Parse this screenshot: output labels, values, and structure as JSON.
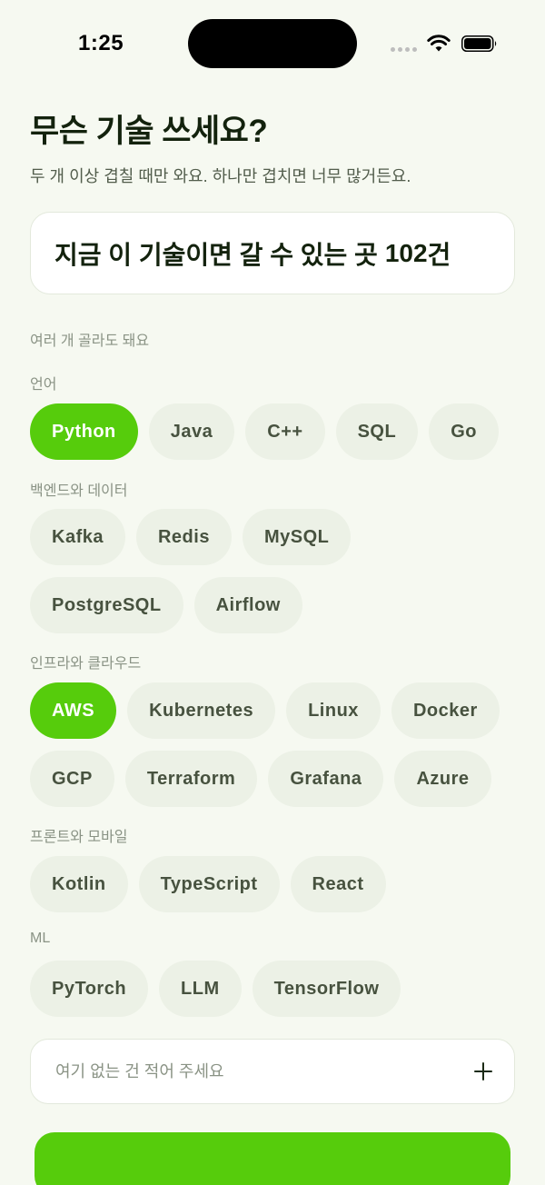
{
  "status_bar": {
    "time": "1:25"
  },
  "header": {
    "title": "무슨 기술 쓰세요?",
    "subtitle": "두 개 이상 겹칠 때만 와요. 하나만 겹치면 너무 많거든요."
  },
  "count_card": {
    "prefix": "지금 이 기술이면 갈 수 있는 곳",
    "count": "102",
    "suffix": "건"
  },
  "hint": "여러 개 골라도 돼요",
  "groups": [
    {
      "label": "언어",
      "chips": [
        {
          "label": "Python",
          "selected": true
        },
        {
          "label": "Java",
          "selected": false
        },
        {
          "label": "C++",
          "selected": false
        },
        {
          "label": "SQL",
          "selected": false
        },
        {
          "label": "Go",
          "selected": false
        }
      ]
    },
    {
      "label": "백엔드와 데이터",
      "chips": [
        {
          "label": "Kafka",
          "selected": false
        },
        {
          "label": "Redis",
          "selected": false
        },
        {
          "label": "MySQL",
          "selected": false
        },
        {
          "label": "PostgreSQL",
          "selected": false
        },
        {
          "label": "Airflow",
          "selected": false
        }
      ]
    },
    {
      "label": "인프라와 클라우드",
      "chips": [
        {
          "label": "AWS",
          "selected": true
        },
        {
          "label": "Kubernetes",
          "selected": false
        },
        {
          "label": "Linux",
          "selected": false
        },
        {
          "label": "Docker",
          "selected": false
        },
        {
          "label": "GCP",
          "selected": false
        },
        {
          "label": "Terraform",
          "selected": false
        },
        {
          "label": "Grafana",
          "selected": false
        },
        {
          "label": "Azure",
          "selected": false
        }
      ]
    },
    {
      "label": "프론트와 모바일",
      "chips": [
        {
          "label": "Kotlin",
          "selected": false
        },
        {
          "label": "TypeScript",
          "selected": false
        },
        {
          "label": "React",
          "selected": false
        }
      ]
    },
    {
      "label": "ML",
      "chips": [
        {
          "label": "PyTorch",
          "selected": false
        },
        {
          "label": "LLM",
          "selected": false
        },
        {
          "label": "TensorFlow",
          "selected": false
        }
      ]
    }
  ],
  "custom_input": {
    "placeholder": "여기 없는 건 적어 주세요",
    "value": ""
  },
  "colors": {
    "accent": "#56cc0c",
    "chip_bg": "#ecf1e6",
    "background": "#f6f9f1"
  }
}
